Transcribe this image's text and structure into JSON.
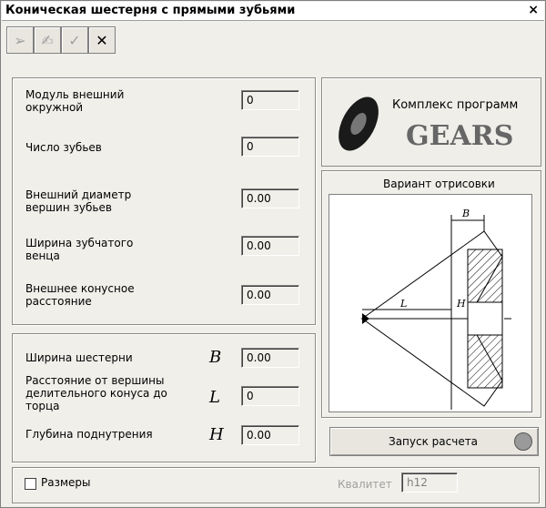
{
  "window": {
    "title": "Коническая шестерня с прямыми зубьями",
    "close_glyph": "×"
  },
  "toolbar": {
    "icons": [
      "arrow-icon",
      "pencil-icon",
      "check-icon",
      "cross-icon"
    ],
    "glyphs": [
      "➢",
      "✍",
      "✓",
      "✕"
    ]
  },
  "params": [
    {
      "label": "Модуль внешний окружной",
      "value": "0"
    },
    {
      "label": "Число зубьев",
      "value": "0"
    },
    {
      "label": "Внешний диаметр вершин зубьев",
      "value": "0.00"
    },
    {
      "label": "Ширина зубчатого венца",
      "value": "0.00"
    },
    {
      "label": "Внешнее конусное расстояние",
      "value": "0.00"
    }
  ],
  "dims": [
    {
      "label": "Ширина шестерни",
      "symbol": "B",
      "value": "0.00"
    },
    {
      "label": "Расстояние от вершины делительного конуса до торца",
      "symbol": "L",
      "value": "0"
    },
    {
      "label": "Глубина поднутрения",
      "symbol": "H",
      "value": "0.00"
    }
  ],
  "logo": {
    "line1": "Комплекс программ",
    "line2": "GEARS"
  },
  "drawing": {
    "title": "Вариант отрисовки",
    "label_b": "B",
    "label_l": "L",
    "label_h": "H"
  },
  "run_button": "Запуск расчета",
  "footer": {
    "sizes_label": "Размеры",
    "kvalitet_label": "Квалитет",
    "kvalitet_value": "h12"
  }
}
